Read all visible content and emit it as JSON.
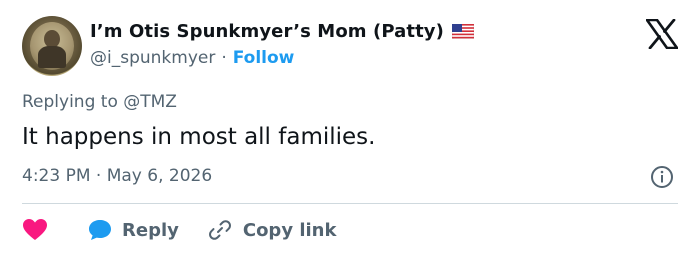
{
  "tweet": {
    "author_name": "I’m Otis Spunkmyer’s Mom (Patty)",
    "handle": "@i_spunkmyer",
    "separator": "·",
    "follow_label": "Follow",
    "replying_to": "Replying to @TMZ",
    "text": "It happens in most all families.",
    "timestamp": "4:23 PM · May 6, 2026"
  },
  "actions": {
    "reply_label": "Reply",
    "copy_link_label": "Copy link"
  },
  "icons": {
    "flag": "us-flag-icon",
    "logo": "x-logo-icon",
    "info": "info-icon",
    "like": "heart-icon",
    "reply": "chat-bubble-icon",
    "link": "link-icon"
  },
  "colors": {
    "accent": "#1d9bf0",
    "like": "#f91880",
    "secondary_text": "#536471",
    "primary_text": "#0f1419"
  }
}
